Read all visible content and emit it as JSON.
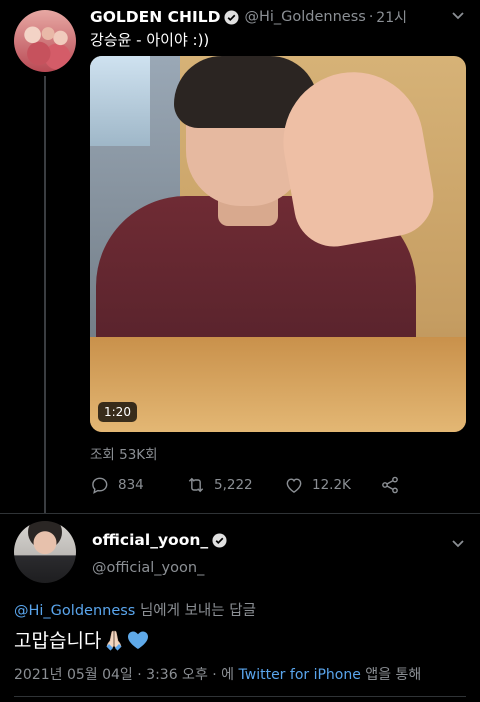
{
  "tweet1": {
    "display_name": "GOLDEN CHILD",
    "handle": "@Hi_Goldenness",
    "separator": "·",
    "time": "21시",
    "text": "강승윤 - 아이야 :))",
    "media": {
      "duration": "1:20"
    },
    "views": "조회 53K회",
    "actions": {
      "replies": "834",
      "retweets": "5,222",
      "likes": "12.2K"
    }
  },
  "tweet2": {
    "display_name": "official_yoon_",
    "handle": "@official_yoon_",
    "reply_to": {
      "mention": "@Hi_Goldenness",
      "suffix": " 님에게 보내는 답글"
    },
    "text": "고맙습니다",
    "meta": {
      "date": "2021년 05월 04일",
      "sep1": " · ",
      "time": "3:36 오후",
      "sep2": " · 에 ",
      "source": "Twitter for iPhone",
      "suffix": " 앱을 통해"
    }
  },
  "colors": {
    "background": "#000000",
    "link": "#5aa5ec",
    "muted": "#8b8f94",
    "heart_emoji": "#5fa9e8"
  }
}
